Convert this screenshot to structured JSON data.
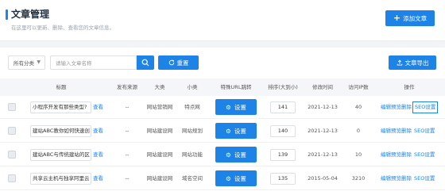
{
  "header": {
    "title": "文章管理",
    "subtitle": "在这里可以更新、删除、查看您的文章信息。",
    "add_button": "添加文章"
  },
  "filters": {
    "category_selected": "所有分类",
    "search_placeholder": "请输入文章名称",
    "reset_label": "重置",
    "export_label": "文章导出"
  },
  "table": {
    "columns": [
      "标题",
      "发布来源",
      "大类",
      "小类",
      "特殊URL跳转",
      "排序(大到小)",
      "修改时间",
      "访问IP数",
      "操作"
    ],
    "view_label": "查看",
    "set_label": "设置",
    "actions": {
      "edit": "编辑",
      "preview": "预览",
      "delete": "删除",
      "seo": "SEO设置"
    },
    "rows": [
      {
        "title": "小程序开发有那些类型?",
        "source": "--",
        "category": "网站营销网",
        "subcategory": "特点网",
        "sort": "141",
        "modified": "2021-12-13",
        "ip_count": "40"
      },
      {
        "title": "建站ABC教你如何快速创",
        "source": "--",
        "category": "网站建设网",
        "subcategory": "网站规划",
        "sort": "140",
        "modified": "2021-12-13",
        "ip_count": "0"
      },
      {
        "title": "建站ABC与传统建站的区",
        "source": "--",
        "category": "网站建设网",
        "subcategory": "网站功能",
        "sort": "139",
        "modified": "2021-12-13",
        "ip_count": "10"
      },
      {
        "title": "共享云主机与独享阿里云",
        "source": "--",
        "category": "网站建设网",
        "subcategory": "域名空间",
        "sort": "135",
        "modified": "2015-05-04",
        "ip_count": "3210"
      }
    ]
  },
  "colors": {
    "accent": "#1e83e6"
  }
}
